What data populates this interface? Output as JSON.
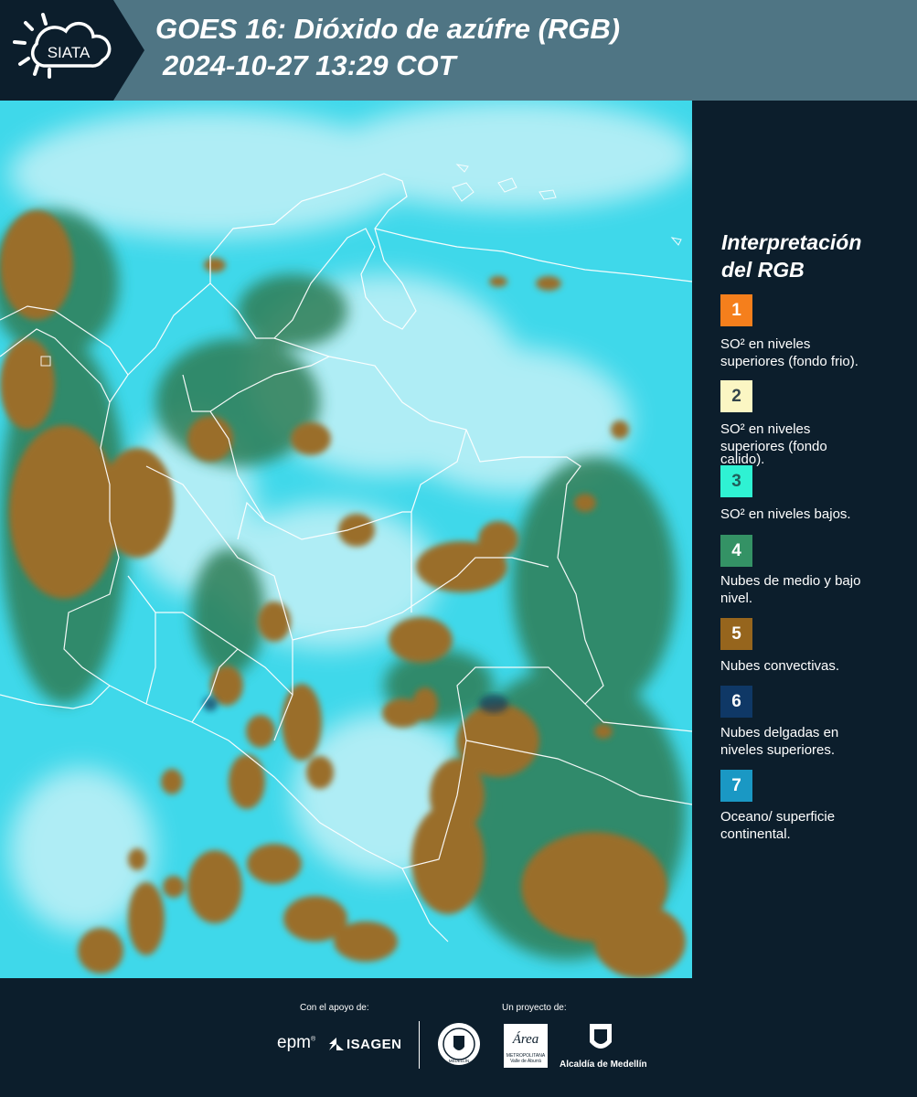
{
  "header": {
    "logo_text": "SIATA",
    "title_line1": "GOES 16: Dióxido de azúfre (RGB)",
    "title_line2": "2024-10-27 13:29 COT"
  },
  "legend": {
    "title_line1": "Interpretación",
    "title_line2": "del RGB",
    "items": [
      {
        "num": "1",
        "color": "#f57f1c",
        "text_color": "#ffffff",
        "line1": "SO² en niveles",
        "line2": "superiores (fondo frio)."
      },
      {
        "num": "2",
        "color": "#fbf6c3",
        "text_color": "#33444a",
        "line1": "SO² en niveles",
        "line2": "superiores (fondo",
        "line3": "calido)."
      },
      {
        "num": "3",
        "color": "#2ff2d3",
        "text_color": "#1f5f5a",
        "line1": "SO² en niveles bajos."
      },
      {
        "num": "4",
        "color": "#349265",
        "text_color": "#ffffff",
        "line1": "Nubes de medio y bajo",
        "line2": "nivel."
      },
      {
        "num": "5",
        "color": "#96651d",
        "text_color": "#ffffff",
        "line1": "Nubes convectivas."
      },
      {
        "num": "6",
        "color": "#0f3866",
        "text_color": "#ffffff",
        "line1": "Nubes delgadas en",
        "line2": "niveles superiores."
      },
      {
        "num": "7",
        "color": "#1a98c4",
        "text_color": "#ffffff",
        "line1": "Oceano/ superficie",
        "line2": "continental."
      }
    ]
  },
  "footer": {
    "support_label": "Con el apoyo de:",
    "project_label": "Un proyecto de:",
    "sponsor1": "epm",
    "sponsor2": "ISAGEN",
    "partner_area_line1": "Área",
    "partner_area_line2": "METROPOLITANA",
    "partner_area_line3": "Valle de Aburrá",
    "partner_alcaldia": "Alcaldía de Medellín",
    "partner_medellin_seal": "MEDELLÍN"
  },
  "colors": {
    "background": "#0c1e2c",
    "header_band": "#4f7584",
    "map_cyan": "#3fd8ea",
    "map_cloud": "#bff0f6",
    "map_convective": "#9a6e2a",
    "map_green": "#2f7a4e"
  }
}
